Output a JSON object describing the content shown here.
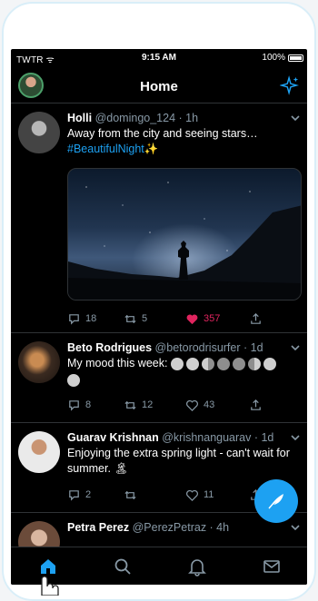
{
  "status": {
    "carrier": "TWTR",
    "time": "9:15 AM",
    "battery": "100%"
  },
  "header": {
    "title": "Home"
  },
  "colors": {
    "accent": "#1da1f2",
    "like": "#e0245e",
    "background": "#000000",
    "muted": "#8899a6"
  },
  "tweets": [
    {
      "name": "Holli",
      "handle": "@domingo_124 · 1h",
      "text": "Away from the city and seeing stars…",
      "hashtag": "#BeautifulNight✨",
      "media": "night-sky-silhouette-photo",
      "replies": "18",
      "retweets": "5",
      "likes": "357",
      "liked": true
    },
    {
      "name": "Beto Rodrigues",
      "handle": "@betorodrisurfer · 1d",
      "text": "My mood this week:",
      "replies": "8",
      "retweets": "12",
      "likes": "43"
    },
    {
      "name": "Guarav Krishnan",
      "handle": "@krishnanguarav · 1d",
      "text": "Enjoying the extra spring light - can't wait for summer. 🏝",
      "replies": "2",
      "retweets": "",
      "likes": "11"
    },
    {
      "name": "Petra Perez",
      "handle": "@PerezPetraz · 4h"
    }
  ],
  "tabs": [
    "home-icon",
    "search-icon",
    "notifications-icon",
    "messages-icon"
  ],
  "compose": {
    "icon": "compose-feather-icon"
  }
}
